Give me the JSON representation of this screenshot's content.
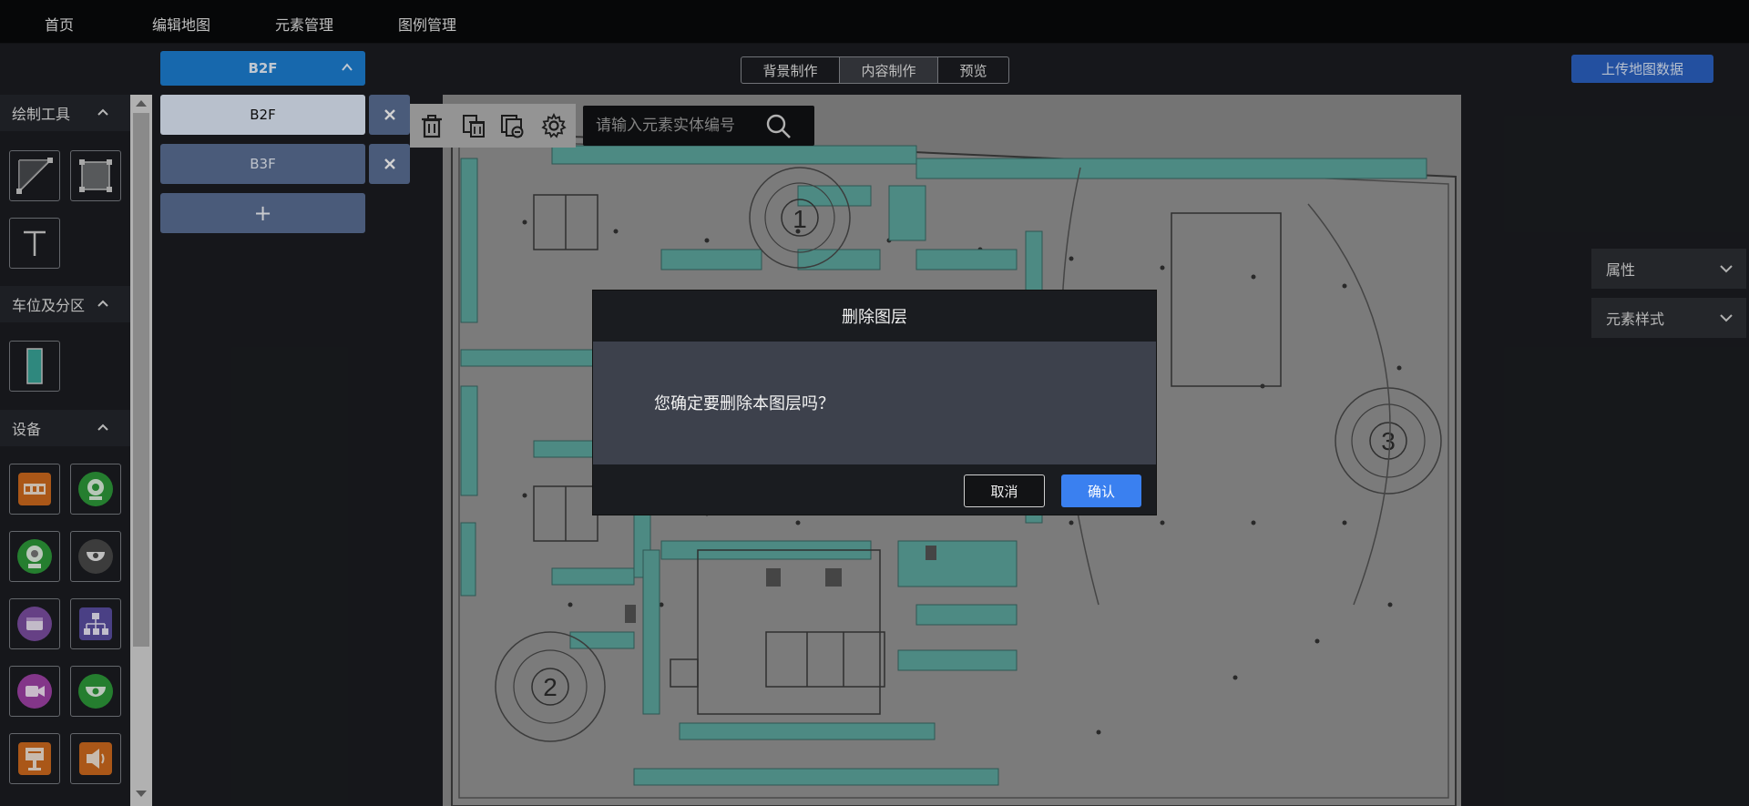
{
  "nav": {
    "home": "首页",
    "edit_map": "编辑地图",
    "element_mgmt": "元素管理",
    "legend_mgmt": "图例管理"
  },
  "floor_select": {
    "current": "B2F"
  },
  "mode_tabs": [
    {
      "label": "背景制作",
      "active": false
    },
    {
      "label": "内容制作",
      "active": true
    },
    {
      "label": "预览",
      "active": false
    }
  ],
  "upload_button": "上传地图数据",
  "left_panel": {
    "drawing_tools": {
      "title": "绘制工具",
      "tools": [
        "line-tool-icon",
        "rectangle-tool-icon",
        "text-tool-icon"
      ]
    },
    "parking": {
      "title": "车位及分区",
      "tools": [
        "parking-space-icon"
      ]
    },
    "devices": {
      "title": "设备",
      "tools": [
        "license-plate-camera-icon",
        "green-dome-camera-icon",
        "green-webcam-icon",
        "gray-dome-camera-icon",
        "purple-barrier-icon",
        "network-topology-icon",
        "purple-video-camera-icon",
        "green-ptz-camera-icon",
        "orange-guidance-screen-icon",
        "orange-speaker-icon"
      ]
    }
  },
  "floor_dropdown": {
    "items": [
      {
        "label": "B2F",
        "selected": true
      },
      {
        "label": "B3F",
        "selected": false
      }
    ],
    "add_label": "+",
    "delete_icon": "close-icon"
  },
  "toolbar": {
    "icons": [
      "trash-icon",
      "trash-copy-icon",
      "copy-remove-icon",
      "gear-icon"
    ]
  },
  "search": {
    "placeholder": "请输入元素实体编号"
  },
  "right_panel": {
    "properties": "属性",
    "element_style": "元素样式"
  },
  "map": {
    "zone_labels": [
      "1",
      "2",
      "3"
    ]
  },
  "modal": {
    "title": "删除图层",
    "message": "您确定要删除本图层吗？",
    "cancel": "取消",
    "confirm": "确认"
  },
  "colors": {
    "primary": "#1d7fd3",
    "confirm": "#3a80f0",
    "parking": "#5fa9a0",
    "upload": "#2b62c4"
  }
}
